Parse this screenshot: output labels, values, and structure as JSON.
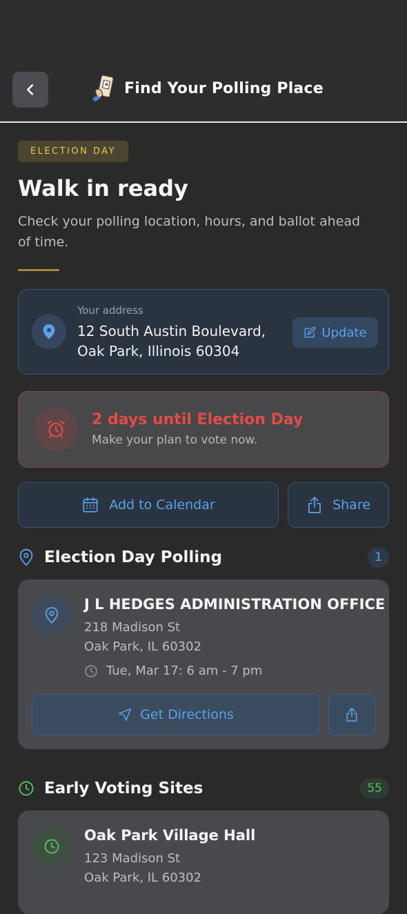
{
  "header": {
    "title": "Find Your Polling Place",
    "back_icon": "chevron-left-icon",
    "title_icon": "phone-ballot-icon"
  },
  "hero": {
    "badge": "ELECTION DAY",
    "title": "Walk in ready",
    "subtitle": "Check your polling location, hours, and ballot ahead of time."
  },
  "address": {
    "label": "Your address",
    "value": "12 South Austin Boulevard, Oak Park, Illinois 60304",
    "update_label": "Update",
    "icon": "map-pin-icon"
  },
  "countdown": {
    "title": "2 days until Election Day",
    "subtitle": "Make your plan to vote now.",
    "icon": "alarm-clock-icon"
  },
  "actions": {
    "calendar_label": "Add to Calendar",
    "share_label": "Share"
  },
  "election_day_section": {
    "title": "Election Day Polling",
    "count": "1",
    "places": [
      {
        "name": "J L HEDGES ADMINISTRATION OFFICE",
        "address_line1": "218 Madison St",
        "address_line2": "Oak Park, IL 60302",
        "hours": "Tue, Mar 17: 6 am - 7 pm",
        "directions_label": "Get Directions"
      }
    ]
  },
  "early_voting_section": {
    "title": "Early Voting Sites",
    "count": "55",
    "places": [
      {
        "name": "Oak Park Village Hall",
        "address_line1": "123 Madison St",
        "address_line2": "Oak Park, IL 60302"
      }
    ]
  },
  "colors": {
    "accent_blue": "#5aa2ea",
    "alert_red": "#e34b48",
    "gold": "#e9c84a",
    "green": "#4cbf60",
    "background": "#2a2a2b"
  }
}
